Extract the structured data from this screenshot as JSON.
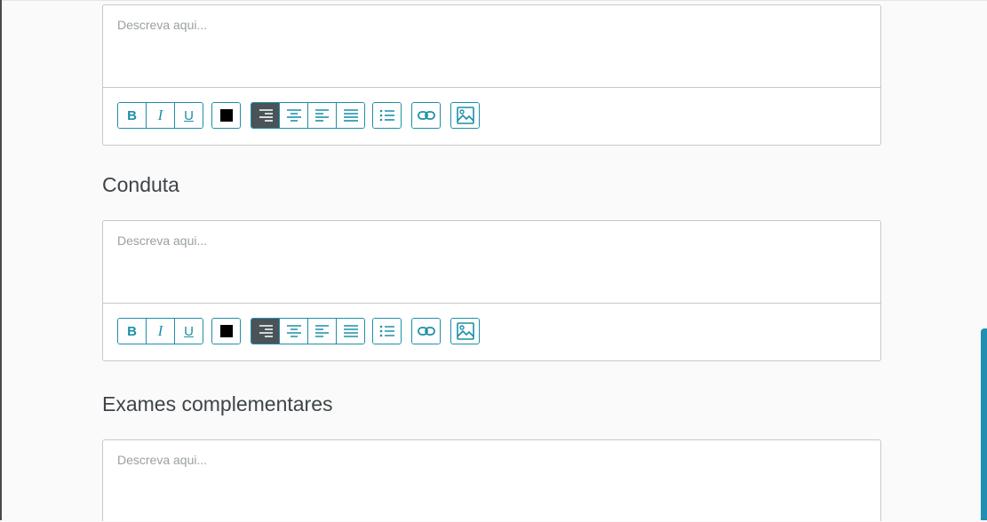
{
  "placeholder_text": "Descreva aqui...",
  "sections": [
    {
      "title": ""
    },
    {
      "title": "Conduta"
    },
    {
      "title": "Exames complementares"
    }
  ],
  "toolbar": {
    "bold_label": "B",
    "italic_label": "I",
    "underline_label": "U",
    "text_color": "#000000",
    "accent_color": "#1d8fa8",
    "active_align": "align-right",
    "icons": [
      "align-right-icon",
      "align-center-icon",
      "align-left-icon",
      "align-justify-icon",
      "bullet-list-icon",
      "link-icon",
      "image-icon"
    ]
  }
}
